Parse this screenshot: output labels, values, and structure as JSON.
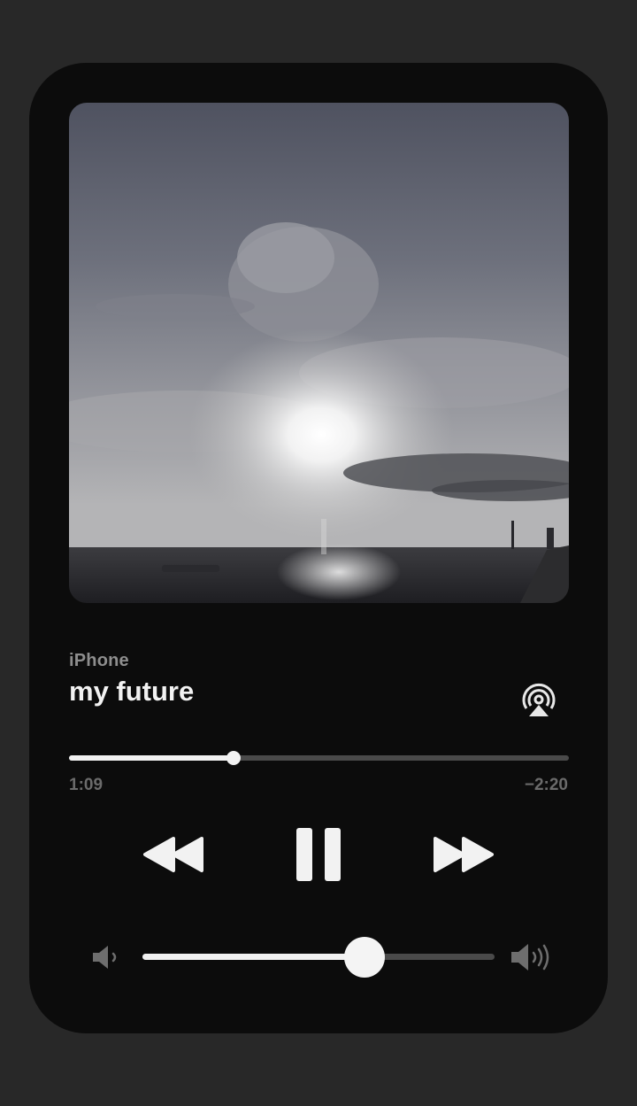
{
  "player": {
    "source": "iPhone",
    "title": "my future",
    "elapsed": "1:09",
    "remaining": "−2:20",
    "progress": 0.33,
    "volume": 0.63
  },
  "icons": {
    "airplay": "airplay-icon",
    "rewind": "rewind-icon",
    "pause": "pause-icon",
    "forward": "fast-forward-icon",
    "volume_low": "volume-low-icon",
    "volume_high": "volume-high-icon"
  },
  "colors": {
    "background": "#282828",
    "card": "#0c0c0c",
    "foreground": "#f2f2f2",
    "secondary_text": "#8e8e8e",
    "track": "#4a4a4a"
  }
}
